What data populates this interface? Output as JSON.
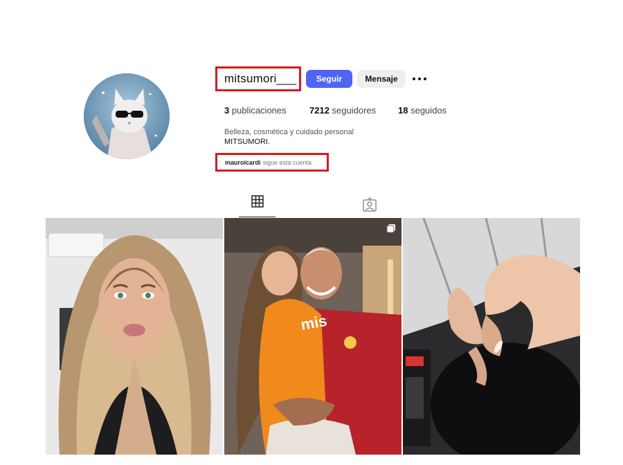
{
  "profile": {
    "username": "mitsumori___",
    "follow_label": "Seguir",
    "message_label": "Mensaje",
    "stats": {
      "posts_count": "3",
      "posts_label": "publicaciones",
      "followers_count": "7212",
      "followers_label": "seguidores",
      "following_count": "18",
      "following_label": "seguidos"
    },
    "category": "Belleza, cosmética y cuidado personal",
    "bio": "MITSUMORI.",
    "followed_by_user": "mauroicardi",
    "followed_by_text": "sigue esta cuenta"
  },
  "tabs": [
    {
      "name": "posts",
      "icon": "grid-icon",
      "active": true
    },
    {
      "name": "tagged",
      "icon": "tagged-icon",
      "active": false
    }
  ],
  "posts": [
    {
      "icon": "photo"
    },
    {
      "icon": "carousel-icon"
    },
    {
      "icon": "photo"
    }
  ],
  "colors": {
    "accent_blue": "#4f64f5",
    "highlight_red": "#d7191f",
    "jersey_orange": "#f08a1c",
    "jersey_red": "#b8232b"
  }
}
